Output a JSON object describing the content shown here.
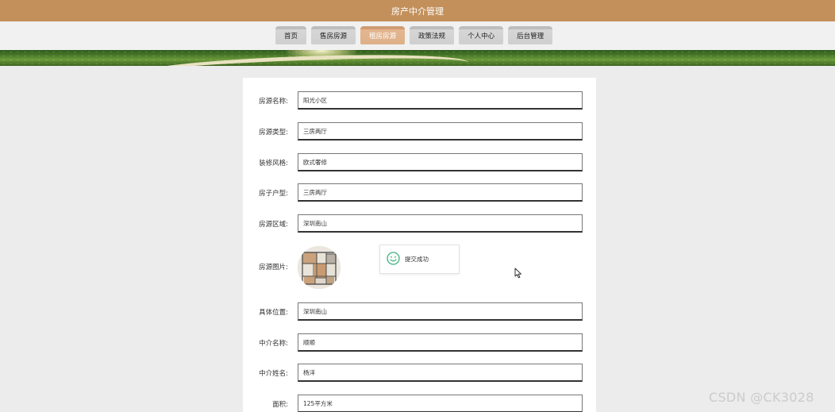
{
  "app": {
    "title": "房产中介管理"
  },
  "nav": {
    "items": [
      {
        "label": "首页",
        "active": false
      },
      {
        "label": "售房房源",
        "active": false
      },
      {
        "label": "租房房源",
        "active": true
      },
      {
        "label": "政策法规",
        "active": false
      },
      {
        "label": "个人中心",
        "active": false
      },
      {
        "label": "后台管理",
        "active": false
      }
    ]
  },
  "form": {
    "fields": [
      {
        "label": "房源名称:",
        "value": "阳光小区"
      },
      {
        "label": "房源类型:",
        "value": "三房两厅"
      },
      {
        "label": "装修风格:",
        "value": "欧式奢修"
      },
      {
        "label": "房子户型:",
        "value": "三房两厅"
      },
      {
        "label": "房源区域:",
        "value": "深圳南山"
      },
      {
        "label": "具体位置:",
        "value": "深圳南山"
      },
      {
        "label": "中介名称:",
        "value": "顺顺"
      },
      {
        "label": "中介姓名:",
        "value": "杨洋"
      },
      {
        "label": "面积:",
        "value": "125平方米"
      }
    ],
    "image_label": "房源图片:"
  },
  "toast": {
    "text": "提交成功",
    "icon": "smile-icon"
  },
  "watermark": "CSDN @CK3028",
  "colors": {
    "titlebar": "#c3905b",
    "nav_active": "#e4b690",
    "nav_inactive": "#cfcfcf",
    "toast_icon": "#3bb27a"
  }
}
